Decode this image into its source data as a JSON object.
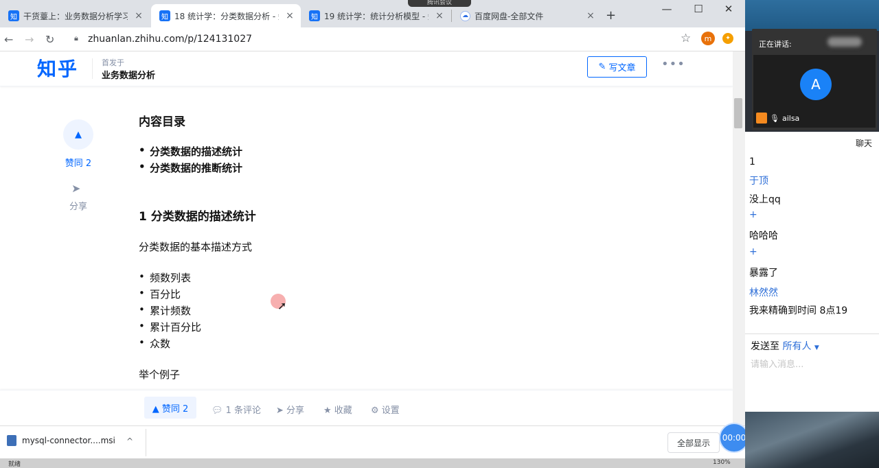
{
  "browser": {
    "tabs": [
      {
        "favicon": "知",
        "title": "干货薹上：业务数据分析学习目",
        "active": false
      },
      {
        "favicon": "知",
        "title": "18 统计学：分类数据分析 - 知",
        "active": true
      },
      {
        "favicon": "知",
        "title": "19 统计学：统计分析模型 - 知",
        "active": false
      },
      {
        "favicon": "pan-icon",
        "title": "百度网盘-全部文件",
        "active": false
      }
    ],
    "tab_close": "×",
    "new_tab": "+",
    "window": {
      "minimize": "—",
      "maximize": "☐",
      "close": "✕"
    },
    "meeting_pill": "腾讯会议",
    "url": "zhuanlan.zhihu.com/p/124131027",
    "extensions": [
      {
        "letter": "m",
        "color": "#e8710a"
      },
      {
        "letter": "✦",
        "color": "#f59f00"
      }
    ]
  },
  "zhihu": {
    "logo": "知乎",
    "publish_label": "首发于",
    "column_name": "业务数据分析",
    "write_button": "写文章",
    "more": "•••",
    "sidebar": {
      "vote_label": "赞同 2",
      "share_label": "分享"
    },
    "article": {
      "toc_title": "内容目录",
      "toc_items": [
        "分类数据的描述统计",
        "分类数据的推断统计"
      ],
      "section_title": "1 分类数据的描述统计",
      "intro": "分类数据的基本描述方式",
      "methods": [
        "频数列表",
        "百分比",
        "累计频数",
        "累计百分比",
        "众数"
      ],
      "example": "举个例子"
    },
    "actionbar": {
      "vote": "▲ 赞同 2",
      "comments": "1 条评论",
      "share": "分享",
      "favorite": "收藏",
      "settings": "设置"
    }
  },
  "downloads": {
    "file_name": "mysql-connector....msi",
    "show_all": "全部显示"
  },
  "meeting": {
    "speaking_label": "正在讲话:",
    "avatar_letter": "A",
    "user_name": "ailsa",
    "timer": "00:00",
    "chat_title": "聊天",
    "messages": [
      {
        "type": "text",
        "text": "1"
      },
      {
        "type": "sender",
        "text": "于顶"
      },
      {
        "type": "text",
        "text": "没上qq"
      },
      {
        "type": "sender",
        "text": "+"
      },
      {
        "type": "text",
        "text": "哈哈哈"
      },
      {
        "type": "sender",
        "text": "+"
      },
      {
        "type": "text",
        "text": "暴露了"
      },
      {
        "type": "sender",
        "text": "林然然"
      },
      {
        "type": "text",
        "text": "我来精确到时间 8点19"
      }
    ],
    "send_to_label": "发送至",
    "send_target": "所有人",
    "input_placeholder": "请输入消息..."
  },
  "statusbar": {
    "left": "就绪",
    "zoom": "130%"
  }
}
